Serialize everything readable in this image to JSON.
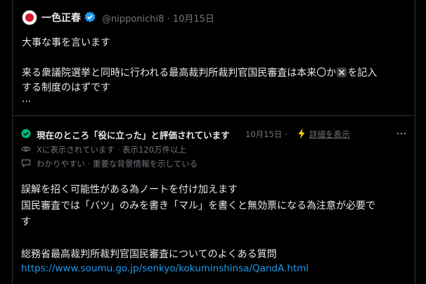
{
  "tweet": {
    "author_name": "一色正春",
    "handle": "@nipponichi8 · 10月15日",
    "line1": "大事な事を言います",
    "line2_before": "来る衆議院選挙と同時に行われる最高裁判所裁判官国民審査は本来〇か",
    "line2_after": "を記入",
    "line3": "する制度のはずです",
    "line4": "..."
  },
  "note": {
    "title": "現在のところ「役に立った」と評価されています",
    "date": "10月15日 ·",
    "details_link": "詳細を表示",
    "views_text": "Xに表示されています · 表示120万件以上",
    "reason_text": "わかりやすい · 重要な背景情報を示している",
    "body_line1": "誤解を招く可能性がある為ノートを付け加えます",
    "body_line2": "国民審査では「バツ」のみを書き「マル」を書くと無効票になる為注意が必要で",
    "body_line3": "す",
    "body_line4": "総務省最高裁判所裁判官国民審査についてのよくある質問",
    "url": "https://www.soumu.go.jp/senkyo/kokuminshinsa/QandA.html"
  },
  "colors": {
    "background": "#000000",
    "text": "#e7e9ea",
    "muted": "#71767b",
    "link": "#1d9bf0",
    "verified": "#1d9bf0",
    "note_check": "#00ba7c",
    "bolt": "#ffd400"
  },
  "icons": [
    "verified-badge-icon",
    "cross-mark-icon",
    "check-circle-icon",
    "lightning-bolt-icon",
    "more-options-icon",
    "eye-icon",
    "comment-icon"
  ]
}
